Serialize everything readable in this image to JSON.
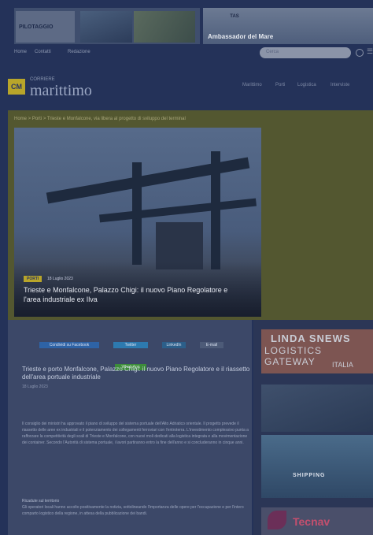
{
  "ads": {
    "top_left_brand": "PILOTAGGIO",
    "top_left_tag": "",
    "top_right_brand": "TAS",
    "top_right_text": "Ambassador del Mare"
  },
  "nav": {
    "links": [
      "Home",
      "Contatti",
      "Redazione"
    ],
    "search_placeholder": "Cerca"
  },
  "brand": {
    "small": "CORRIERE",
    "name": "marittimo",
    "mark": "CM"
  },
  "menu": [
    "Marittimo",
    "Porti",
    "Logistica",
    "Interviste"
  ],
  "hero": {
    "breadcrumb": "Home > Porti > Trieste e Monfalcone, via libera al progetto di sviluppo del terminal",
    "badge": "PORTI",
    "date": "18 Luglio 2023",
    "title": "Trieste e Monfalcone, Palazzo Chigi: il nuovo Piano Regolatore e l'area industriale ex Ilva"
  },
  "share": {
    "facebook": "Condividi su Facebook",
    "twitter": "Twitter",
    "linkedin": "LinkedIn",
    "email": "E-mail",
    "whatsapp": "WhatsApp"
  },
  "article": {
    "title": "Trieste e porto Monfalcone, Palazzo Chigi: il nuovo Piano Regolatore e il riassetto dell'area portuale industriale",
    "date": "18 Luglio 2023",
    "body": "Il consiglio dei ministri ha approvato il piano di sviluppo del sistema portuale dell'Alto Adriatico orientale. Il progetto prevede il riassetto delle aree ex industriali e il potenziamento dei collegamenti ferroviari con l'entroterra. L'investimento complessivo punta a rafforzare la competitività degli scali di Trieste e Monfalcone, con nuovi moli dedicati alla logistica integrata e alla movimentazione dei container. Secondo l'Autorità di sistema portuale, i lavori partiranno entro la fine dell'anno e si concluderanno in cinque anni.",
    "subhead": "Ricadute sul territorio",
    "body2": "Gli operatori locali hanno accolto positivamente la notizia, sottolineando l'importanza delle opere per l'occupazione e per l'intero comparto logistico della regione, in attesa della pubblicazione dei bandi."
  },
  "sidebar": {
    "ad1_line1": "LINDA SNEWS",
    "ad1_line2": "LOGISTICS GATEWAY",
    "ad1_line3": "ITALIA",
    "ad3_text": "SHIPPING",
    "ad4_text": "Tecnav"
  },
  "colors": {
    "background": "#243259",
    "hero_yellow": "#535730",
    "accent": "#b8a52a",
    "facebook": "#2e63a6",
    "whatsapp": "#3c8c3a"
  }
}
